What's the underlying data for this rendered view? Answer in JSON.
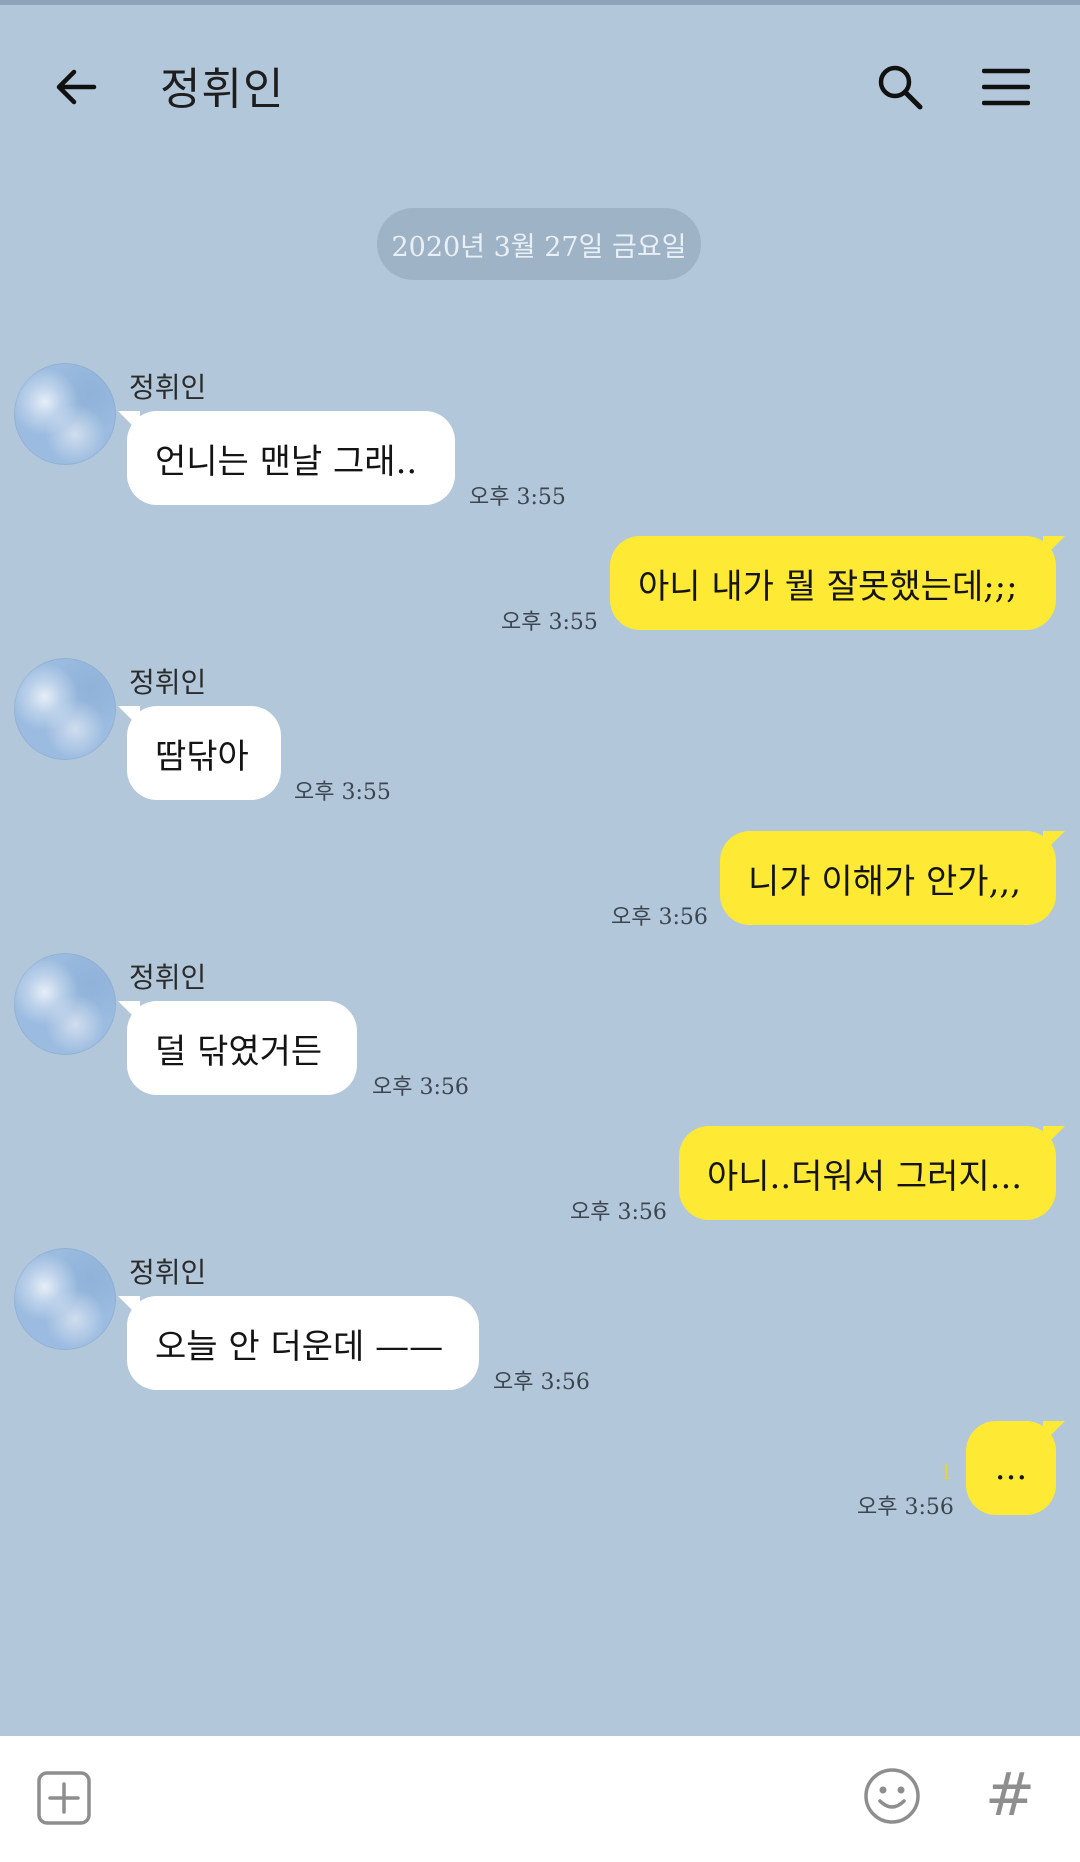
{
  "header": {
    "title": "정휘인",
    "back_icon": "arrow-left-icon",
    "search_icon": "search-icon",
    "menu_icon": "hamburger-menu-icon"
  },
  "date_divider": "2020년 3월 27일 금요일",
  "messages": [
    {
      "direction": "in",
      "sender": "정휘인",
      "text": "언니는 맨날 그래..",
      "time": "오후 3:55"
    },
    {
      "direction": "out",
      "text": "아니 내가 뭘 잘못했는데;;;",
      "time": "오후 3:55"
    },
    {
      "direction": "in",
      "sender": "정휘인",
      "text": "땀닦아",
      "time": "오후 3:55"
    },
    {
      "direction": "out",
      "text": "니가 이해가 안가,,,",
      "time": "오후 3:56"
    },
    {
      "direction": "in",
      "sender": "정휘인",
      "text": "덜 닦였거든",
      "time": "오후 3:56"
    },
    {
      "direction": "out",
      "text": "아니..더워서 그러지...",
      "time": "오후 3:56"
    },
    {
      "direction": "in",
      "sender": "정휘인",
      "text": "오늘 안 더운데 ——",
      "time": "오후 3:56"
    },
    {
      "direction": "out",
      "text": "...",
      "time": "오후 3:56",
      "unread": "1"
    }
  ],
  "input_bar": {
    "plus_icon": "plus-box-icon",
    "emoji_icon": "emoji-icon",
    "hash_icon": "hash-icon",
    "hash_glyph": "#"
  },
  "colors": {
    "background": "#b2c7da",
    "outgoing_bubble": "#fee934",
    "incoming_bubble": "#ffffff"
  }
}
